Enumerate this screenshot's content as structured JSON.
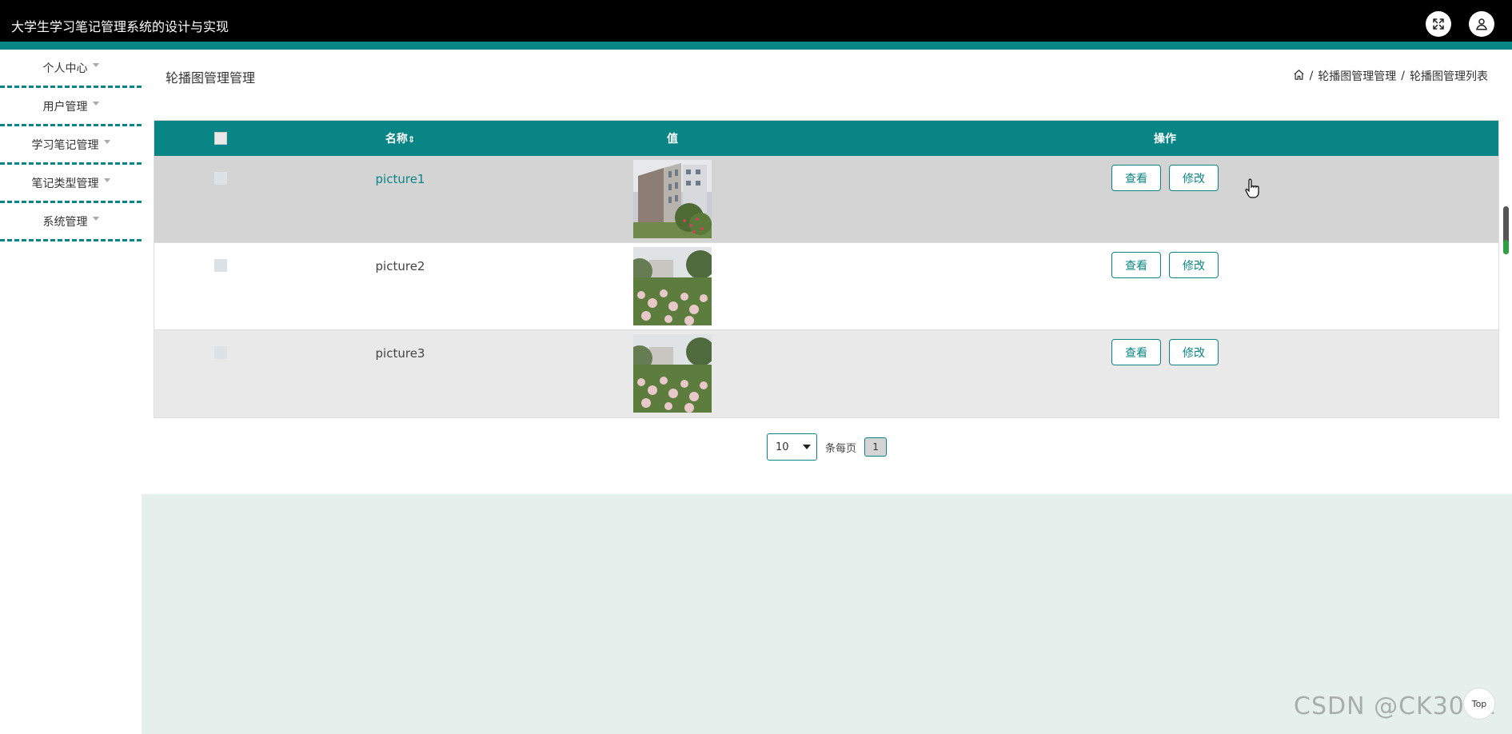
{
  "header": {
    "title": "大学生学习笔记管理系统的设计与实现",
    "fullscreen_icon": "fullscreen-icon",
    "user_icon": "user-icon"
  },
  "sidebar": {
    "items": [
      {
        "label": "个人中心"
      },
      {
        "label": "用户管理"
      },
      {
        "label": "学习笔记管理"
      },
      {
        "label": "笔记类型管理"
      },
      {
        "label": "系统管理"
      }
    ]
  },
  "main": {
    "page_title": "轮播图管理管理",
    "breadcrumb": {
      "home_icon": "home-icon",
      "separator": "/",
      "items": [
        "轮播图管理管理",
        "轮播图管理列表"
      ]
    },
    "table": {
      "headers": {
        "name": "名称",
        "sort_icon": "⇕",
        "value": "值",
        "ops": "操作"
      },
      "rows": [
        {
          "name": "picture1",
          "view": "查看",
          "edit": "修改"
        },
        {
          "name": "picture2",
          "view": "查看",
          "edit": "修改"
        },
        {
          "name": "picture3",
          "view": "查看",
          "edit": "修改"
        }
      ]
    },
    "pagination": {
      "page_size": "10",
      "per_page_label": "条每页",
      "current_page": "1"
    }
  },
  "footer": {
    "top_button": "Top",
    "watermark": "CSDN @CK3011"
  },
  "colors": {
    "accent": "#0a8585",
    "header_bg": "#000000",
    "panel_bg": "#e5f0ed"
  }
}
